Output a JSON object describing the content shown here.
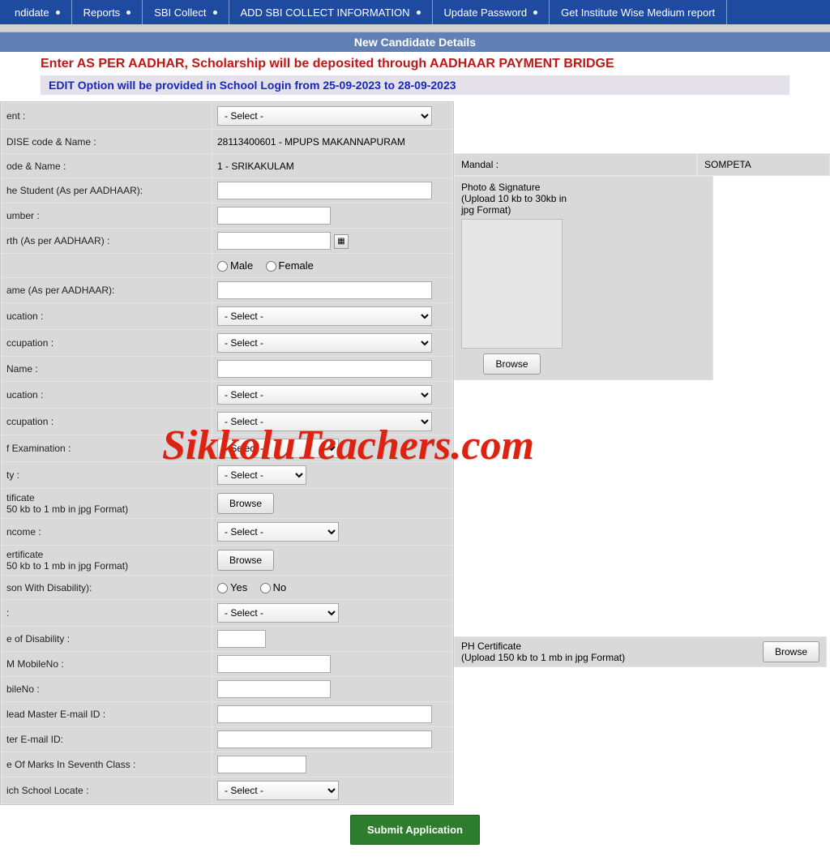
{
  "nav": {
    "candidate": "ndidate",
    "reports": "Reports",
    "sbi_collect": "SBI Collect",
    "add_sbi_info": "ADD SBI COLLECT INFORMATION",
    "update_password": "Update Password",
    "get_report": "Get Institute Wise Medium report"
  },
  "titles": {
    "page": "New Candidate Details",
    "banner1": "Enter AS PER AADHAR, Scholarship will be deposited through AADHAAR PAYMENT BRIDGE",
    "banner2": "EDIT Option will be provided in School Login from 25-09-2023 to 28-09-2023"
  },
  "labels": {
    "dept": "ent :",
    "udise": "DISE code & Name :",
    "dist": "ode & Name :",
    "name": "he Student (As per AADHAAR):",
    "aadhar": "umber :",
    "dob": "rth (As per AADHAAR) :",
    "father": "ame (As per AADHAAR):",
    "father_edu": "ucation :",
    "father_occ": "ccupation :",
    "mother": "Name :",
    "mother_edu": "ucation :",
    "mother_occ": "ccupation :",
    "medium": "f Examination :",
    "community": "ty :",
    "caste_cert": "tificate",
    "caste_cert_hint": "50 kb to 1 mb in jpg Format)",
    "income": "ncome :",
    "income_cert": "ertificate",
    "income_cert_hint": "50 kb to 1 mb in jpg Format)",
    "pwd": "son With Disability):",
    "pwd_type": ":",
    "pwd_pct": "e of Disability :",
    "hm_mobile": "M MobileNo :",
    "parent_mobile": "bileNo :",
    "hm_email": "lead Master E-mail ID :",
    "hm_email2": "ter E-mail ID:",
    "marks": "e Of Marks In Seventh Class :",
    "area": "ich School Locate :",
    "mandal": "Mandal :",
    "photo": "Photo & Signature",
    "photo_hint1": "(Upload 10 kb to 30kb in",
    "photo_hint2": "jpg Format)",
    "ph_cert": "PH Certificate",
    "ph_cert_hint": "(Upload 150 kb to 1 mb in jpg Format)"
  },
  "values": {
    "udise": "28113400601 - MPUPS MAKANNAPURAM",
    "district": "1 - SRIKAKULAM",
    "mandal": "SOMPETA",
    "select_ph": "- Select -",
    "male": "Male",
    "female": "Female",
    "yes": "Yes",
    "no": "No"
  },
  "buttons": {
    "browse": "Browse",
    "submit": "Submit Application"
  },
  "watermark": "SikkoluTeachers.com"
}
